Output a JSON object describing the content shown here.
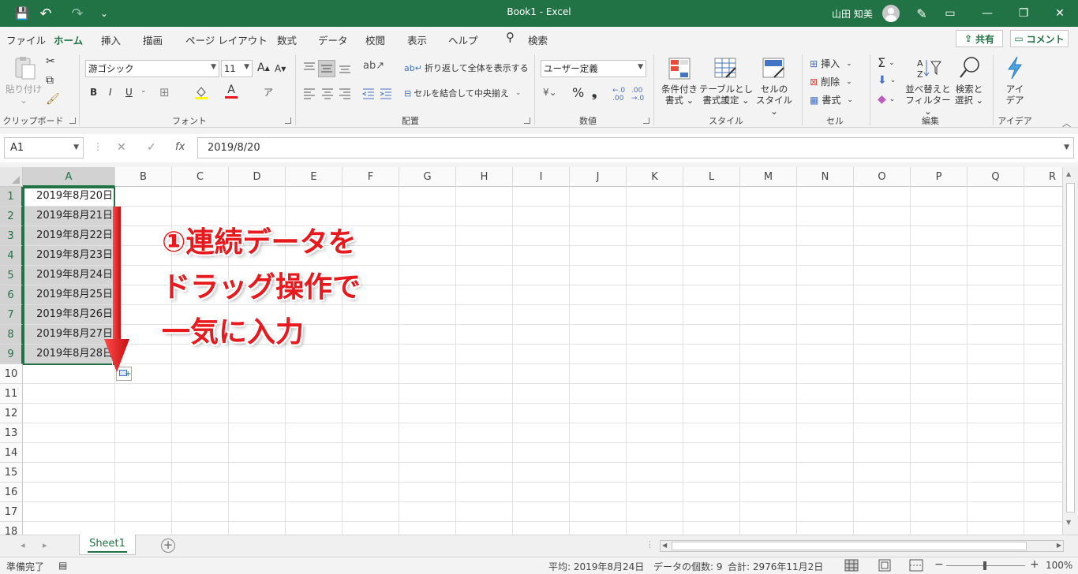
{
  "titlebar": {
    "title": "Book1  -  Excel",
    "user": "山田 知美",
    "save_icon": "💾",
    "undo_icon": "↶",
    "redo_icon": "↷",
    "customize_icon": "⌄",
    "pen_icon": "✎",
    "display_icon": "▭",
    "minimize": "—",
    "restore": "❐",
    "close": "✕"
  },
  "menu": {
    "tabs": [
      "ファイル",
      "ホーム",
      "挿入",
      "描画",
      "ページ レイアウト",
      "数式",
      "データ",
      "校閲",
      "表示",
      "ヘルプ"
    ],
    "search": "検索",
    "search_icon": "⚲",
    "share": "共有",
    "comment": "コメント"
  },
  "ribbon": {
    "groups": [
      "クリップボード",
      "フォント",
      "配置",
      "数値",
      "スタイル",
      "セル",
      "編集",
      "アイデア"
    ],
    "paste": "貼り付け",
    "paste_arrow": "⌄",
    "font_name": "游ゴシック",
    "font_size": "11",
    "bold": "B",
    "italic": "I",
    "underline": "U",
    "wrap_text": "折り返して全体を表示する",
    "merge_center": "セルを結合して中央揃え",
    "number_format": "ユーザー定義",
    "percent": "%",
    "comma": "❟",
    "conditional_format": [
      "条件付き",
      "書式 ⌄"
    ],
    "format_as_table": [
      "テーブルとして",
      "書式設定 ⌄"
    ],
    "cell_styles": [
      "セルの",
      "スタイル ⌄"
    ],
    "insert": "挿入",
    "delete": "削除",
    "format": "書式",
    "sort_filter": [
      "並べ替えと",
      "フィルター ⌄"
    ],
    "find_select": [
      "検索と",
      "選択 ⌄"
    ],
    "ideas": [
      "アイ",
      "デア"
    ]
  },
  "formula_bar": {
    "name_box": "A1",
    "cancel": "✕",
    "enter": "✓",
    "fx": "fx",
    "value": "2019/8/20"
  },
  "sheet": {
    "columns": [
      "A",
      "B",
      "C",
      "D",
      "E",
      "F",
      "G",
      "H",
      "I",
      "J",
      "K",
      "L",
      "M",
      "N",
      "O",
      "P",
      "Q",
      "R"
    ],
    "rows": [
      "1",
      "2",
      "3",
      "4",
      "5",
      "6",
      "7",
      "8",
      "9",
      "10",
      "11",
      "12",
      "13",
      "14",
      "15",
      "16",
      "17",
      "18"
    ],
    "cells_A": [
      "2019年8月20日",
      "2019年8月21日",
      "2019年8月22日",
      "2019年8月23日",
      "2019年8月24日",
      "2019年8月25日",
      "2019年8月26日",
      "2019年8月27日",
      "2019年8月28日"
    ]
  },
  "annotation": {
    "lines": [
      "①連続データを",
      "ドラッグ操作で",
      "一気に入力"
    ],
    "color": "#e8191d"
  },
  "tabs_bar": {
    "sheet_name": "Sheet1",
    "add": "+",
    "prev": "◂",
    "next": "▸"
  },
  "status": {
    "ready": "準備完了",
    "average": "平均: 2019年8月24日",
    "count": "データの個数: 9",
    "sum": "合計: 2976年11月2日",
    "zoom_out": "−",
    "zoom_in": "+",
    "zoom": "100%"
  },
  "colors": {
    "accent": "#217346",
    "selection_fill": "#d4d4d4"
  }
}
